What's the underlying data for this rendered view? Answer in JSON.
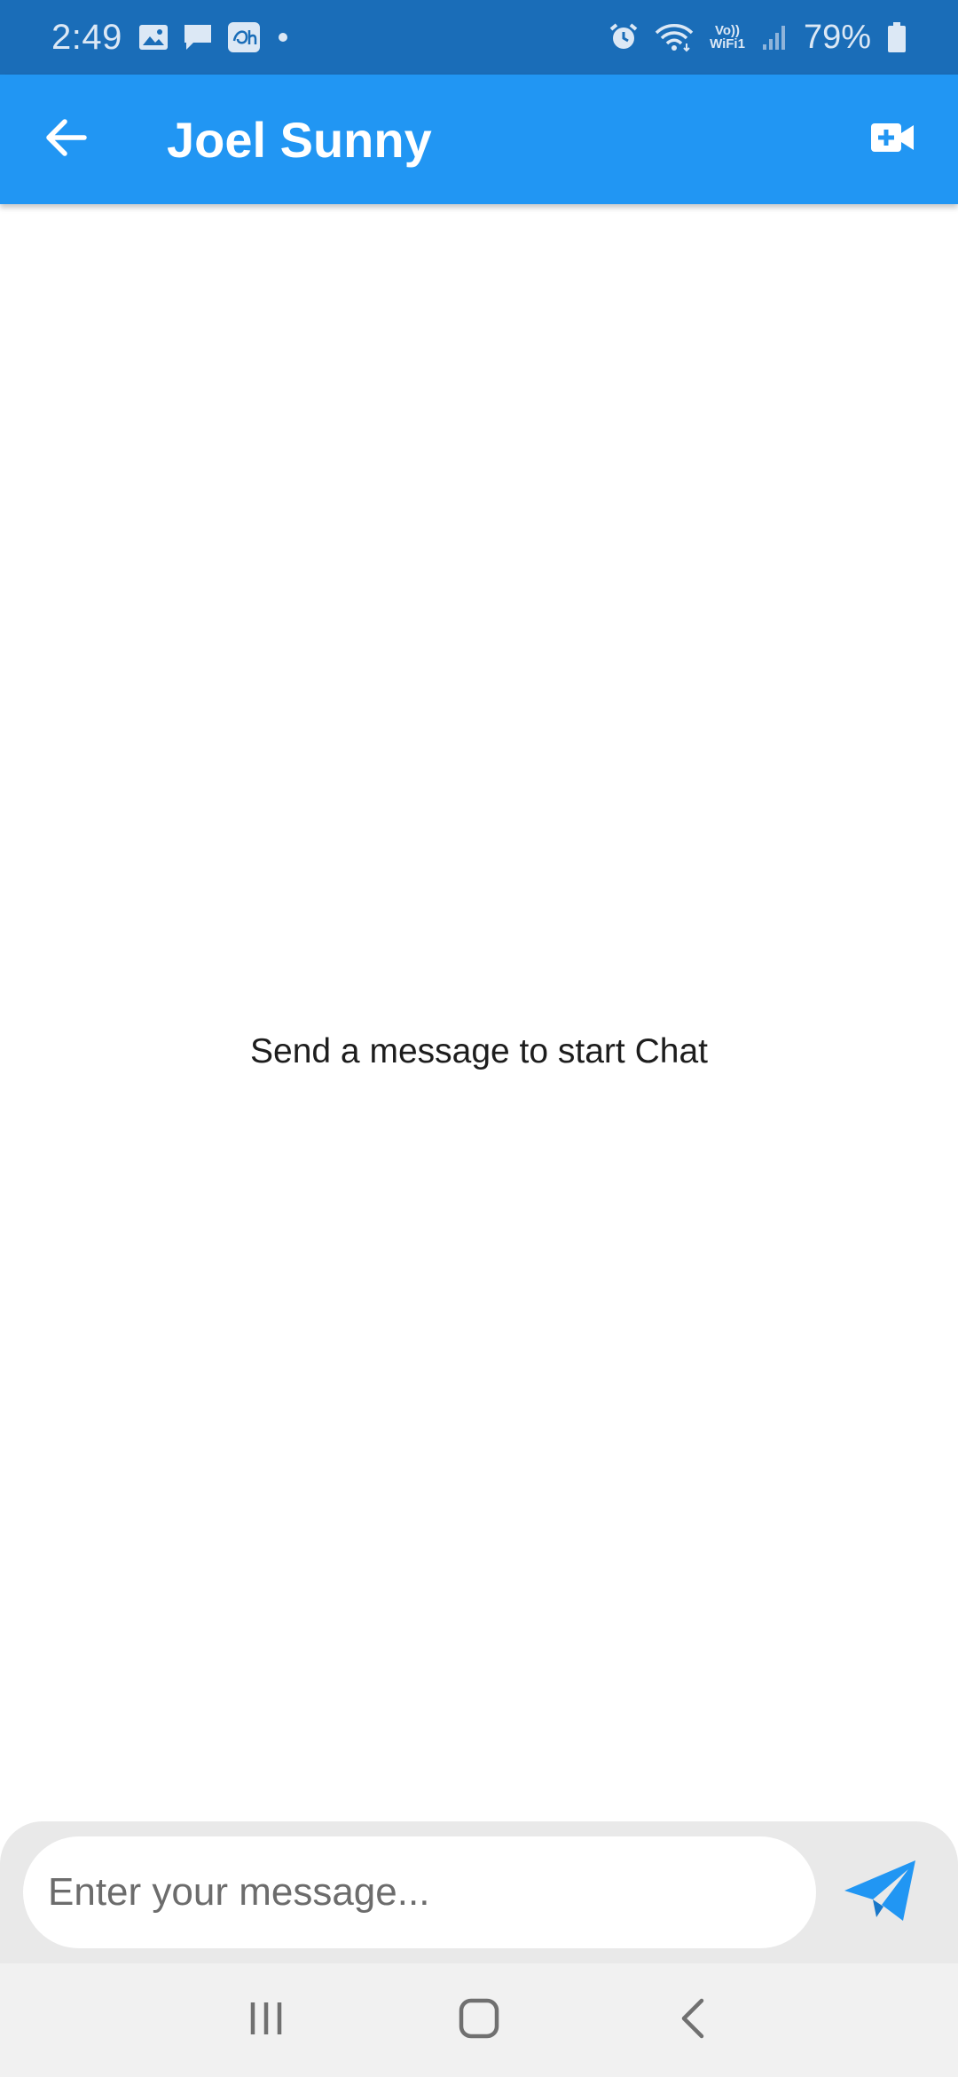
{
  "status_bar": {
    "time": "2:49",
    "battery_percent": "79%",
    "icons_left": [
      "gallery-icon",
      "message-icon",
      "disney-hotstar-icon",
      "dot-icon"
    ],
    "icons_right": [
      "alarm-icon",
      "wifi-icon",
      "vowifi-icon",
      "signal-icon",
      "battery-icon"
    ],
    "vowifi_label_top": "Vo))",
    "vowifi_label_bottom": "WiFi1"
  },
  "app_bar": {
    "title": "Joel Sunny",
    "back_icon": "arrow-back-icon",
    "action_icon": "video-call-icon"
  },
  "chat": {
    "empty_text": "Send a message to start Chat"
  },
  "composer": {
    "value": "",
    "placeholder": "Enter your message...",
    "send_icon": "send-icon"
  },
  "nav_bar": {
    "items": [
      "recents-icon",
      "home-icon",
      "back-icon"
    ]
  },
  "colors": {
    "status_bar": "#1a6db8",
    "app_bar": "#2196f3",
    "send_icon": "#2196f3",
    "composer_bg": "#e9e9e9",
    "nav_bg": "#f1f1f1"
  }
}
